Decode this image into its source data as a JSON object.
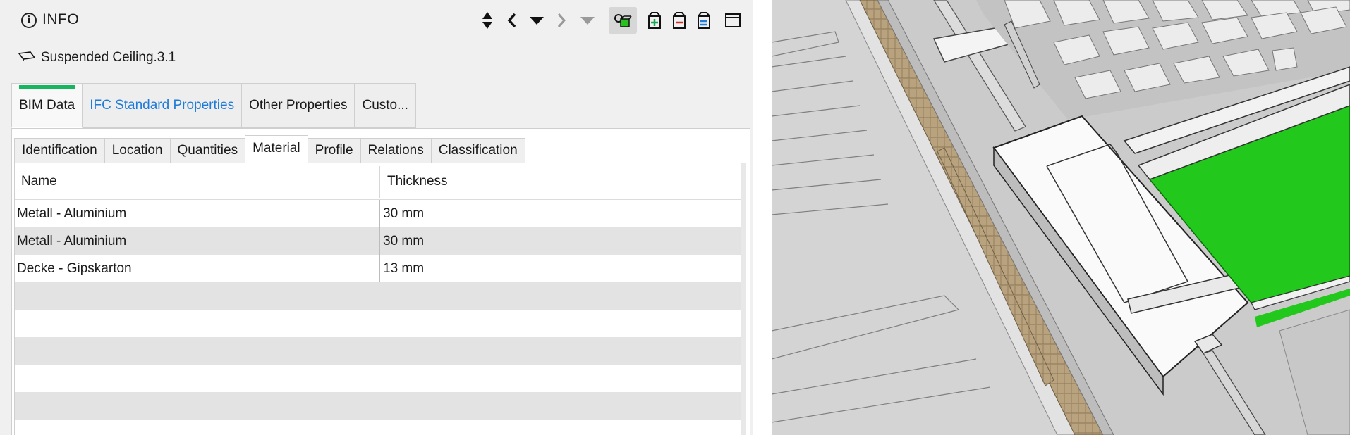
{
  "header": {
    "title": "INFO",
    "info_icon_glyph": "i"
  },
  "toolbar": {
    "icons": [
      "sort-updown-icon",
      "back-icon",
      "filter-down-icon",
      "forward-icon",
      "filter-disabled-icon",
      "highlight-object-icon",
      "add-to-set-icon",
      "remove-from-set-icon",
      "set-list-icon",
      "window-icon"
    ]
  },
  "object": {
    "name": "Suspended Ceiling.3.1"
  },
  "tabs": [
    "BIM Data",
    "IFC Standard Properties",
    "Other Properties",
    "Custo..."
  ],
  "subtabs": [
    "Identification",
    "Location",
    "Quantities",
    "Material",
    "Profile",
    "Relations",
    "Classification"
  ],
  "table": {
    "columns": [
      "Name",
      "Thickness"
    ],
    "rows": [
      {
        "name": "Metall - Aluminium",
        "thickness": "30 mm"
      },
      {
        "name": "Metall - Aluminium",
        "thickness": "30 mm"
      },
      {
        "name": "Decke - Gipskarton",
        "thickness": "13 mm"
      }
    ]
  },
  "colors": {
    "active_tab_indicator": "#17b55e",
    "link_tab": "#1f7bd8",
    "model_highlight": "#22c81c"
  }
}
